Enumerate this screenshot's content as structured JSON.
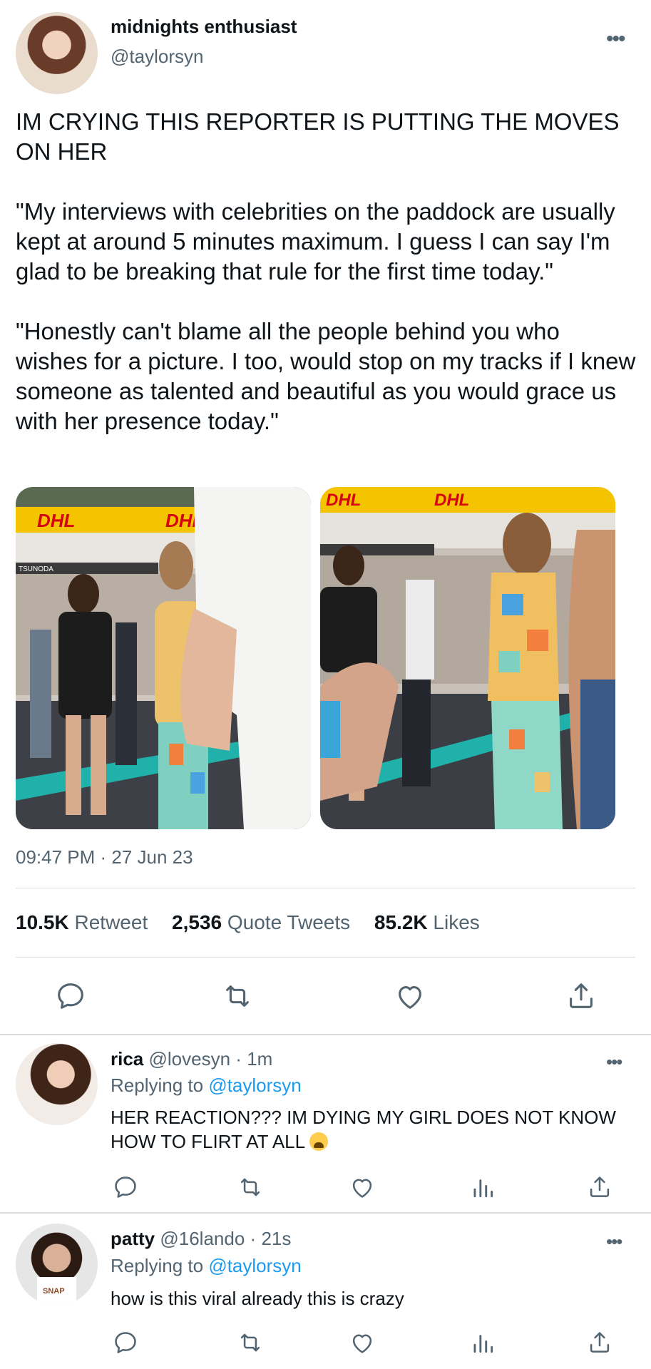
{
  "tweet": {
    "author_name": "midnights enthusiast",
    "author_handle": "@taylorsyn",
    "text_line1": "IM CRYING THIS REPORTER IS PUTTING THE MOVES ON HER",
    "text_para2": "\"My interviews with celebrities on the paddock are usually kept at around 5 minutes maximum. I guess I can say I'm glad to be breaking that rule for the first time today.\"",
    "text_para3": "\"Honestly can't blame all the people behind you who wishes for a picture. I too, would stop on my tracks if I knew someone as talented and beautiful as you would grace us with her presence today.\"",
    "timestamp": "09:47 PM · 27 Jun 23",
    "more_icon": "ellipsis-icon",
    "stats": {
      "retweets_value": "10.5K",
      "retweets_label": "Retweet",
      "quotes_value": "2,536",
      "quotes_label": "Quote Tweets",
      "likes_value": "85.2K",
      "likes_label": "Likes"
    },
    "media_signage": {
      "dhl": "DHL",
      "tsunoda": "TSUNODA"
    }
  },
  "replies": [
    {
      "name": "rica",
      "handle": "@lovesyn",
      "time": "1m",
      "replying_label": "Replying to",
      "replying_handle": "@taylorsyn",
      "text": "HER REACTION??? IM DYING MY GIRL DOES NOT KNOW HOW TO FLIRT AT ALL"
    },
    {
      "name": "patty",
      "handle": "@16lando",
      "time": "21s",
      "replying_label": "Replying to",
      "replying_handle": "@taylorsyn",
      "text": "how is this viral already this is crazy",
      "shirt_text": "SNAP"
    }
  ],
  "colors": {
    "accent": "#1d9bf0",
    "text": "#0f1419",
    "secondary": "#536471",
    "divider": "#d9dee2"
  }
}
